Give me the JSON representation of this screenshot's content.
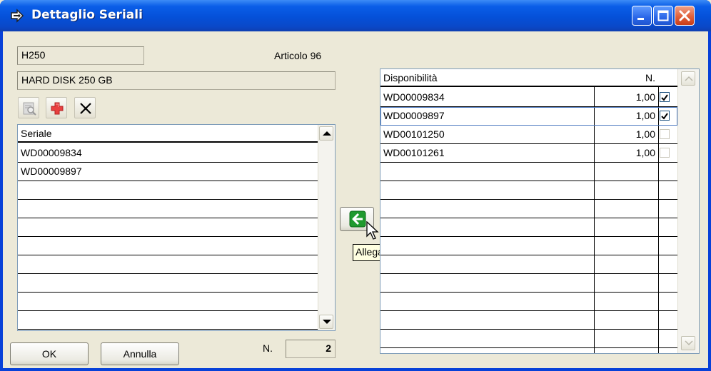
{
  "window": {
    "title": "Dettaglio Seriali",
    "accent": "#0841d8"
  },
  "article": {
    "code": "H250",
    "label": "Articolo 96",
    "description": "HARD DISK 250 GB"
  },
  "toolbar": {
    "icons": [
      "magnifier-icon",
      "add-icon",
      "delete-icon"
    ]
  },
  "left_grid": {
    "header": "Seriale",
    "rows": [
      "WD00009834",
      "WD00009897"
    ]
  },
  "count": {
    "label": "N.",
    "value": "2"
  },
  "buttons": {
    "ok": "OK",
    "cancel": "Annulla",
    "attach_tooltip": "Allega"
  },
  "right_grid": {
    "headers": {
      "availability": "Disponibilità",
      "qty": "N."
    },
    "rows": [
      {
        "serial": "WD00009834",
        "qty": "1,00",
        "checked": true
      },
      {
        "serial": "WD00009897",
        "qty": "1,00",
        "checked": true
      },
      {
        "serial": "WD00101250",
        "qty": "1,00",
        "checked": false
      },
      {
        "serial": "WD00101261",
        "qty": "1,00",
        "checked": false
      }
    ]
  }
}
